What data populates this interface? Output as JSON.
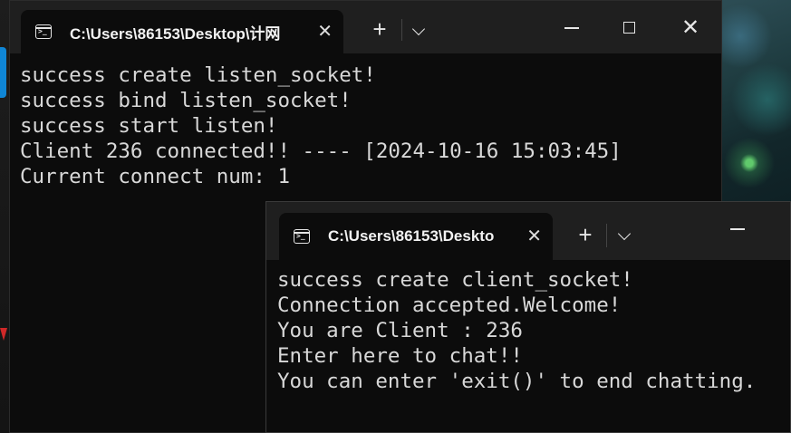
{
  "server_window": {
    "tab_title": "C:\\Users\\86153\\Desktop\\计网",
    "tab_close": "✕",
    "new_tab": "+",
    "close": "✕",
    "lines": [
      "success create listen_socket!",
      "success bind listen_socket!",
      "success start listen!",
      "Client 236 connected!! ---- [2024-10-16 15:03:45]",
      "Current connect num: 1"
    ]
  },
  "client_window": {
    "tab_title": "C:\\Users\\86153\\Deskto",
    "tab_close": "✕",
    "new_tab": "+",
    "lines": [
      "success create client_socket!",
      "Connection accepted.Welcome!",
      "You are Client : 236",
      "Enter here to chat!!",
      "You can enter 'exit()' to end chatting."
    ]
  },
  "icons": {
    "terminal": "terminal-icon",
    "chevron": "chevron-down-icon",
    "minimize": "minimize-icon",
    "maximize": "maximize-icon",
    "close": "close-icon"
  },
  "colors": {
    "console_bg": "#0c0c0c",
    "titlebar_bg": "#1f1f1f",
    "text": "#d8d8d8"
  }
}
